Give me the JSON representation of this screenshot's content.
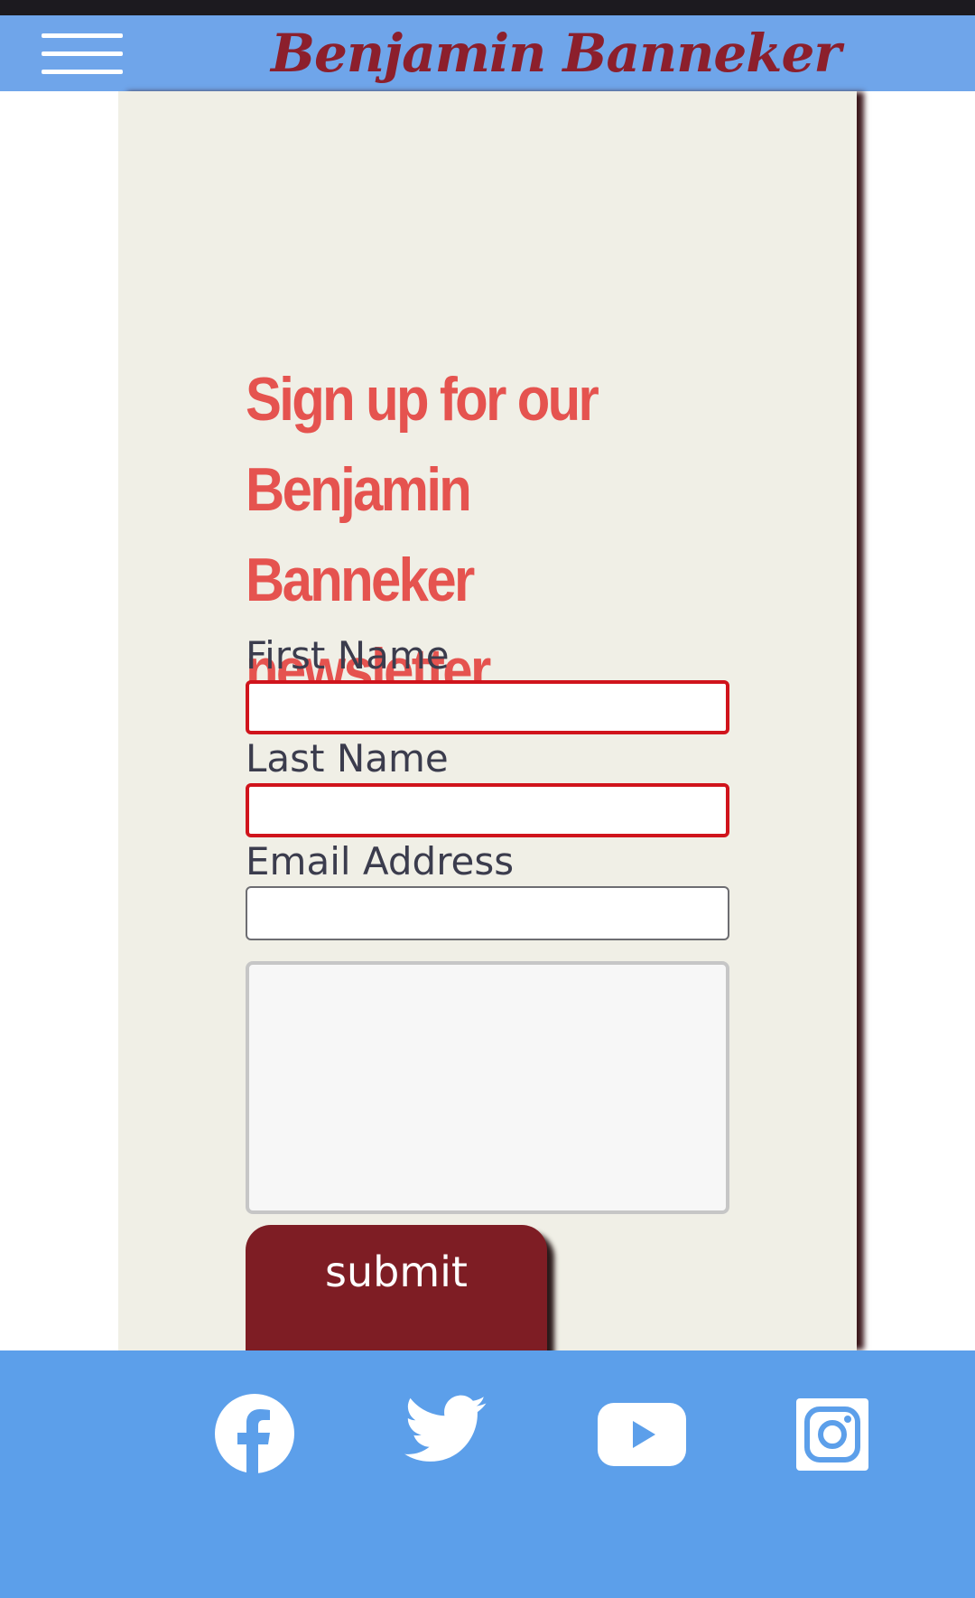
{
  "header": {
    "title": "Benjamin Banneker",
    "menu_icon": "hamburger-menu-icon",
    "background_color": "#6fa5ea",
    "title_color": "#8c1f2c"
  },
  "signup": {
    "heading": "Sign up for our Benjamin Banneker newsletter",
    "heading_color": "#e5534f",
    "first_name_label": "First Name",
    "first_name_value": "",
    "last_name_label": "Last Name",
    "last_name_value": "",
    "email_label": "Email Address",
    "email_value": "",
    "message_value": "",
    "submit_label": "submit",
    "submit_color": "#7e1d24",
    "invalid_border_color": "#d0141c"
  },
  "footer": {
    "background_color": "#5c9fea",
    "social": [
      {
        "name": "facebook",
        "icon": "facebook-icon"
      },
      {
        "name": "twitter",
        "icon": "twitter-icon"
      },
      {
        "name": "youtube",
        "icon": "youtube-icon"
      },
      {
        "name": "instagram",
        "icon": "instagram-icon"
      }
    ]
  }
}
